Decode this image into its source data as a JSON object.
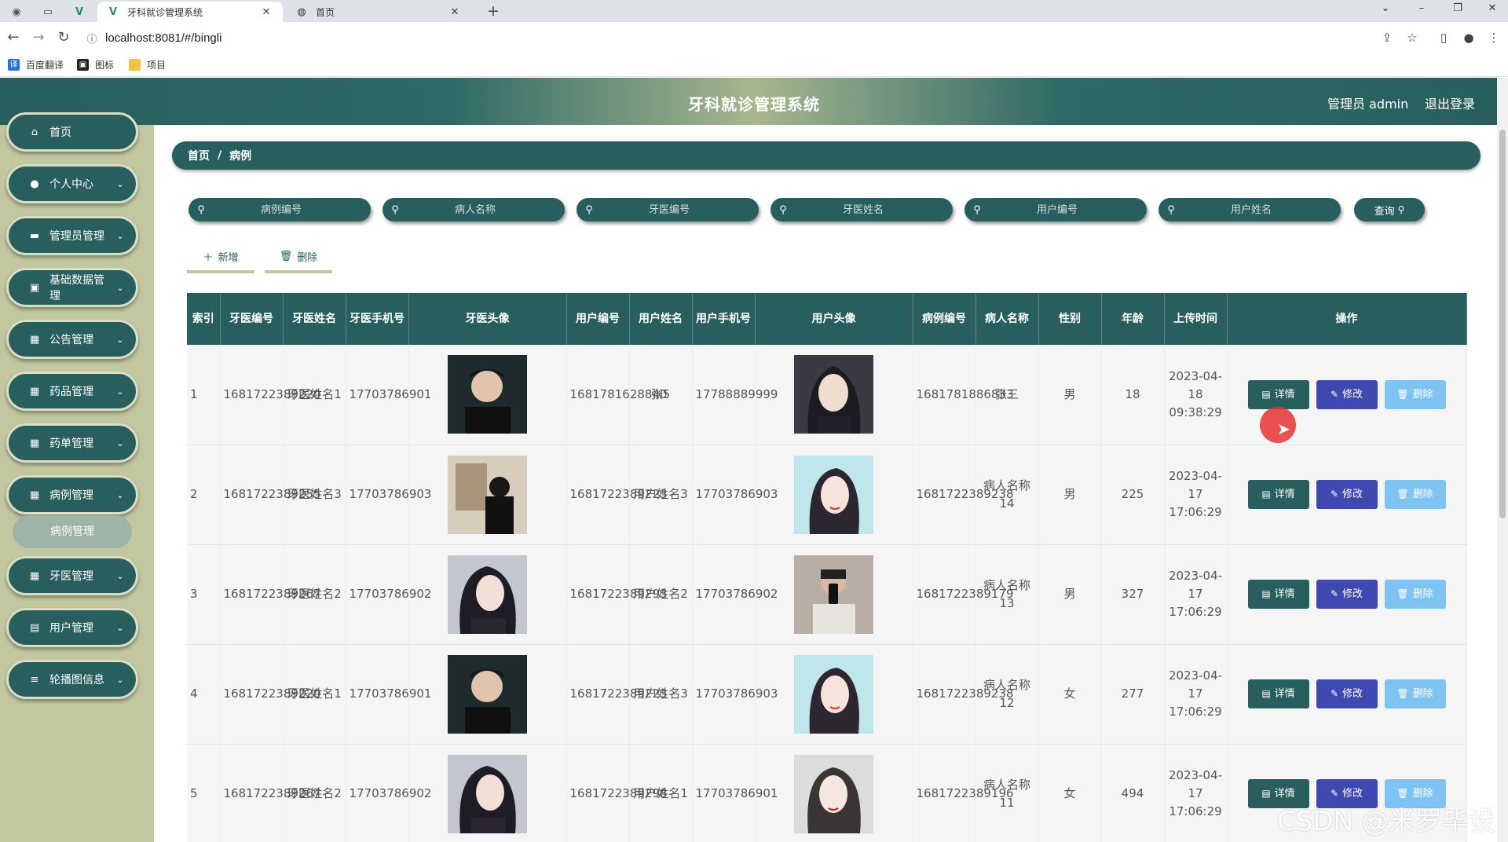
{
  "browser": {
    "tabs": [
      {
        "title": "牙科就诊管理系统",
        "icon": "vue-logo-icon",
        "close": "✕"
      },
      {
        "title": "首页",
        "icon": "globe-icon",
        "close": "✕"
      }
    ],
    "new_tab": "+",
    "url_icon": "ⓘ",
    "url": "localhost:8081/#/bingli",
    "bookmarks": [
      {
        "label": "百度翻译",
        "icon_color": "#2a6fdb"
      },
      {
        "label": "图标",
        "icon_color": "#222222"
      },
      {
        "label": "项目",
        "icon_color": "#f5c242"
      }
    ]
  },
  "header": {
    "title": "牙科就诊管理系统",
    "admin": "管理员 admin",
    "logout": "退出登录"
  },
  "sidebar": {
    "items": [
      {
        "label": "首页",
        "icon": "⌂",
        "caret": ""
      },
      {
        "label": "个人中心",
        "icon": "●",
        "caret": "⌄"
      },
      {
        "label": "管理员管理",
        "icon": "▬",
        "caret": "⌄"
      },
      {
        "label": "基础数据管理",
        "icon": "▣",
        "caret": "⌄"
      },
      {
        "label": "公告管理",
        "icon": "▦",
        "caret": "⌄"
      },
      {
        "label": "药品管理",
        "icon": "▦",
        "caret": "⌄"
      },
      {
        "label": "药单管理",
        "icon": "▦",
        "caret": "⌄"
      },
      {
        "label": "病例管理",
        "icon": "▦",
        "caret": "⌄"
      },
      {
        "label": "牙医管理",
        "icon": "▦",
        "caret": "⌄"
      },
      {
        "label": "用户管理",
        "icon": "▤",
        "caret": "⌄"
      },
      {
        "label": "轮播图信息",
        "icon": "≡",
        "caret": "⌄"
      }
    ],
    "sub_item": "病例管理"
  },
  "breadcrumb": {
    "home": "首页",
    "sep": "/",
    "current": "病例"
  },
  "search": {
    "fields": [
      {
        "placeholder": "病例编号"
      },
      {
        "placeholder": "病人名称"
      },
      {
        "placeholder": "牙医编号"
      },
      {
        "placeholder": "牙医姓名"
      },
      {
        "placeholder": "用户编号"
      },
      {
        "placeholder": "用户姓名"
      }
    ],
    "query_label": "查询"
  },
  "actions": {
    "add_label": "新增",
    "delete_label": "删除"
  },
  "table": {
    "headers": [
      "索引",
      "牙医编号",
      "牙医姓名",
      "牙医手机号",
      "牙医头像",
      "用户编号",
      "用户姓名",
      "用户手机号",
      "用户头像",
      "病例编号",
      "病人名称",
      "性别",
      "年龄",
      "上传时间",
      "操作"
    ],
    "op_labels": {
      "detail": "详情",
      "edit": "修改",
      "delete": "删除"
    },
    "rows": [
      {
        "idx": "1",
        "dentist_no": "1681722389220",
        "dentist_name": "牙医姓名1",
        "dentist_phone": "17703786901",
        "user_no": "1681781628840",
        "user_name": "张5",
        "user_phone": "17788889999",
        "case_no": "1681781886833",
        "patient": "张三",
        "gender": "男",
        "age": "18",
        "time": "2023-04-18 09:38:29"
      },
      {
        "idx": "2",
        "dentist_no": "1681722389255",
        "dentist_name": "牙医姓名3",
        "dentist_phone": "17703786903",
        "user_no": "1681722389223",
        "user_name": "用户姓名3",
        "user_phone": "17703786903",
        "case_no": "1681722389238",
        "patient": "病人名称14",
        "gender": "男",
        "age": "225",
        "time": "2023-04-17 17:06:29"
      },
      {
        "idx": "3",
        "dentist_no": "1681722389267",
        "dentist_name": "牙医姓名2",
        "dentist_phone": "17703786902",
        "user_no": "1681722389293",
        "user_name": "用户姓名2",
        "user_phone": "17703786902",
        "case_no": "1681722389179",
        "patient": "病人名称13",
        "gender": "男",
        "age": "327",
        "time": "2023-04-17 17:06:29"
      },
      {
        "idx": "4",
        "dentist_no": "1681722389220",
        "dentist_name": "牙医姓名1",
        "dentist_phone": "17703786901",
        "user_no": "1681722389223",
        "user_name": "用户姓名3",
        "user_phone": "17703786903",
        "case_no": "1681722389238",
        "patient": "病人名称12",
        "gender": "女",
        "age": "277",
        "time": "2023-04-17 17:06:29"
      },
      {
        "idx": "5",
        "dentist_no": "1681722389267",
        "dentist_name": "牙医姓名2",
        "dentist_phone": "17703786902",
        "user_no": "1681722389298",
        "user_name": "用户姓名1",
        "user_phone": "17703786901",
        "case_no": "1681722389196",
        "patient": "病人名称11",
        "gender": "女",
        "age": "494",
        "time": "2023-04-17 17:06:29"
      }
    ]
  },
  "watermark": "CSDN @米罗毕设",
  "colors": {
    "primary": "#285e5e",
    "sidebar_bg": "#c2c7a0",
    "edit": "#3f48b0",
    "delete": "#7fc3f3"
  }
}
